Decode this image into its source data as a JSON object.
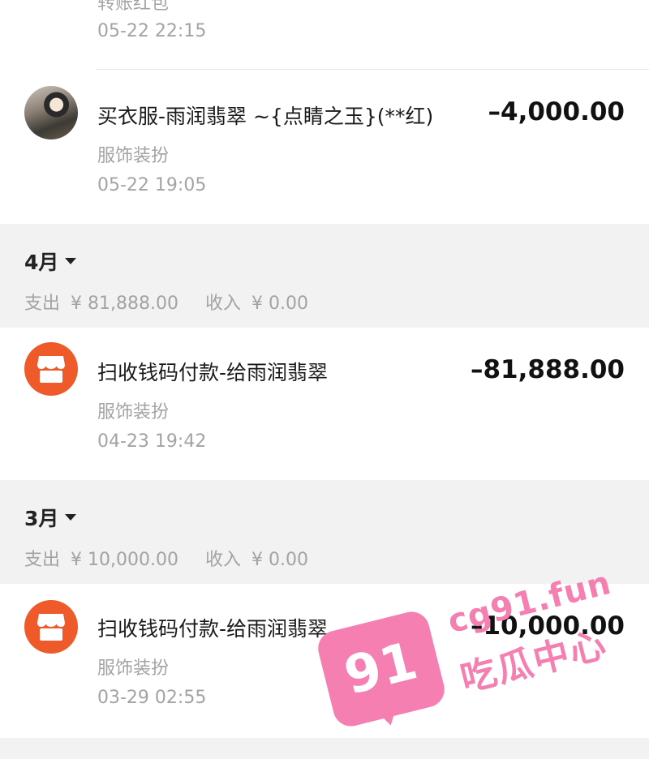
{
  "transactions_top": [
    {
      "title": "转账红包",
      "time": "05-22  22:15"
    },
    {
      "title": "买衣服-雨润翡翠 ~{点睛之玉}(**红)",
      "amount": "–4,000.00",
      "category": "服饰装扮",
      "time": "05-22  19:05",
      "icon": "avatar-photo"
    }
  ],
  "months": [
    {
      "label": "4月",
      "expense_label": "支出",
      "expense_value": "¥ 81,888.00",
      "income_label": "收入",
      "income_value": "¥ 0.00",
      "transaction": {
        "title": "扫收钱码付款-给雨润翡翠",
        "amount": "–81,888.00",
        "category": "服饰装扮",
        "time": "04-23  19:42",
        "icon": "store-icon"
      }
    },
    {
      "label": "3月",
      "expense_label": "支出",
      "expense_value": "¥ 10,000.00",
      "income_label": "收入",
      "income_value": "¥ 0.00",
      "transaction": {
        "title": "扫收钱码付款-给雨润翡翠",
        "amount": "–10,000.00",
        "category": "服饰装扮",
        "time": "03-29  02:55",
        "icon": "store-icon"
      }
    }
  ],
  "watermark": {
    "number": "91",
    "domain": "cg91.fun",
    "name": "吃瓜中心"
  },
  "colors": {
    "store_icon": "#ef5a2a",
    "watermark": "#f57fb1",
    "section_bg": "#f2f2f2"
  }
}
